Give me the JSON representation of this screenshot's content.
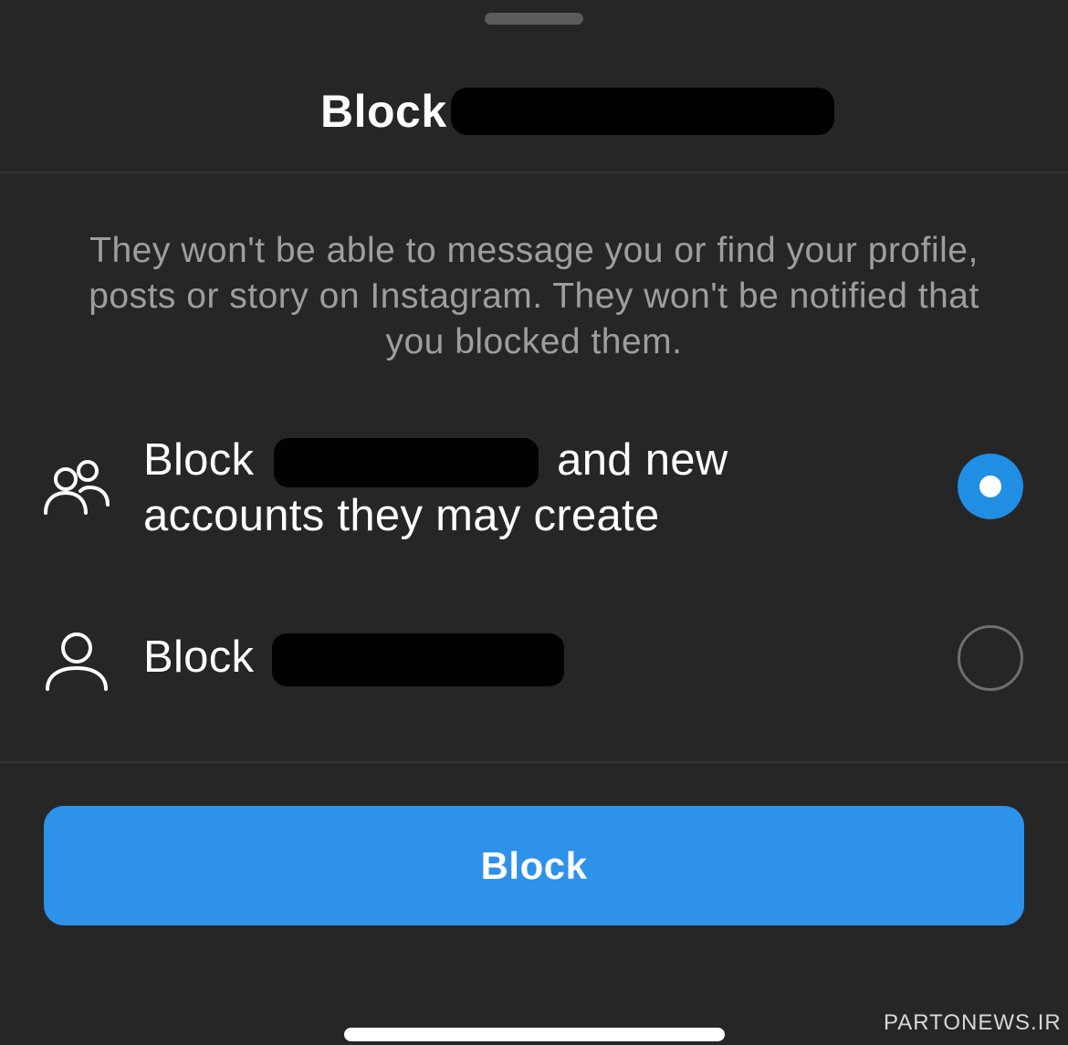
{
  "sheet": {
    "title": "Block",
    "description": "They won't be able to message you or find your profile, posts or story on Instagram. They won't be notified that you blocked them."
  },
  "options": [
    {
      "icon": "people-icon",
      "prefix": "Block",
      "suffix_line1": "and new",
      "line2": "accounts they may create",
      "selected": true
    },
    {
      "icon": "person-icon",
      "prefix": "Block",
      "selected": false
    }
  ],
  "button": {
    "label": "Block",
    "color": "#2e91ea"
  },
  "watermark": "PARTONEWS.IR",
  "colors": {
    "background": "#262626",
    "radio_selected": "#1f8ee3",
    "description_text": "#9e9e9e"
  }
}
